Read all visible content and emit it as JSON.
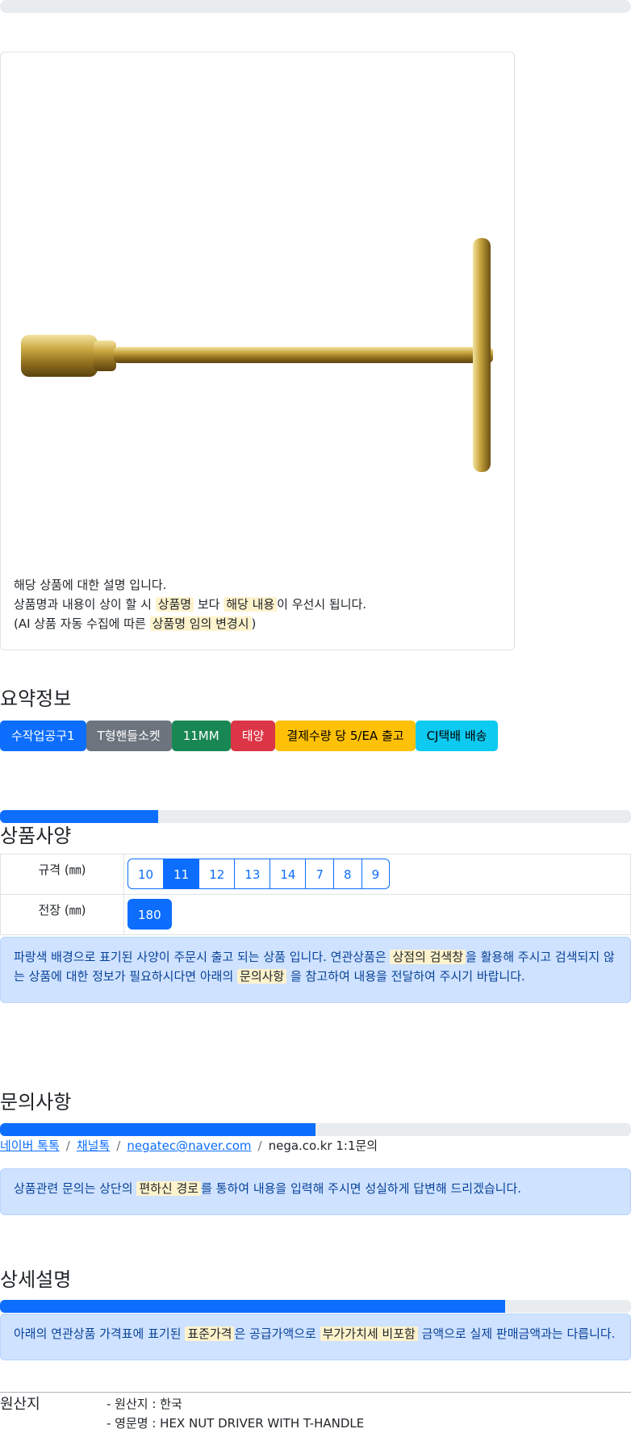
{
  "description": {
    "line1": "해당 상품에 대한 설명 입니다.",
    "line2_a": "상품명과 내용이 상이 할 시 ",
    "line2_mark1": "상품명",
    "line2_b": " 보다 ",
    "line2_mark2": "해당 내용",
    "line2_c": "이 우선시 됩니다.",
    "line3_a": "(AI 상품 자동 수집에 따른 ",
    "line3_mark": "상품명 임의 변경시",
    "line3_b": ")"
  },
  "summary": {
    "title": "요약정보",
    "badges": [
      {
        "label": "수작업공구1",
        "color": "#0d6efd",
        "text": "#ffffff"
      },
      {
        "label": "T형핸들소켓",
        "color": "#6c757d",
        "text": "#ffffff"
      },
      {
        "label": "11MM",
        "color": "#198754",
        "text": "#ffffff"
      },
      {
        "label": "태양",
        "color": "#dc3545",
        "text": "#ffffff"
      },
      {
        "label": "결제수량 당 5/EA 출고",
        "color": "#ffc107",
        "text": "#000000"
      },
      {
        "label": "CJ택배 배송",
        "color": "#0dcaf0",
        "text": "#000000"
      }
    ]
  },
  "spec": {
    "title": "상품사양",
    "progress": 0.25,
    "size_label": "규격 (㎜)",
    "size_options": [
      "10",
      "11",
      "12",
      "13",
      "14",
      "7",
      "8",
      "9"
    ],
    "size_selected": "11",
    "length_label": "전장 (㎜)",
    "length_options": [
      "180"
    ],
    "notice_a": "파랑색 배경으로 표기된 사양이 주문시 출고 되는 상품 입니다. 연관상품은 ",
    "notice_mark1": "상점의 검색창",
    "notice_b": "을 활용해 주시고 검색되지 않는 상품에 대한 정보가 필요하시다면 아래의 ",
    "notice_mark2": "문의사항",
    "notice_c": " 을 참고하여 내용을 전달하여 주시기 바랍니다."
  },
  "inquiry": {
    "title": "문의사항",
    "progress": 0.5,
    "links": [
      "네이버 톡톡",
      "채널톡",
      "negatec@naver.com"
    ],
    "plain": "nega.co.kr 1:1문의",
    "separator": "/",
    "notice_a": "상품관련 문의는 상단의 ",
    "notice_mark": "편하신 경로",
    "notice_b": "를 통하여 내용을 입력해 주시면 성실하게 답변해 드리겠습니다."
  },
  "detail": {
    "title": "상세설명",
    "progress": 0.8,
    "notice_a": "아래의 연관상품 가격표에 표기된 ",
    "notice_mark1": "표준가격",
    "notice_b": "은 공급가액으로 ",
    "notice_mark2": "부가가치세 비포함",
    "notice_c": " 금액으로 실제 판매금액과는 다릅니다."
  },
  "origin": {
    "label": "원산지",
    "line1": "- 원산지 : 한국",
    "line2": "- 영문명 : HEX NUT DRIVER WITH T-HANDLE"
  }
}
